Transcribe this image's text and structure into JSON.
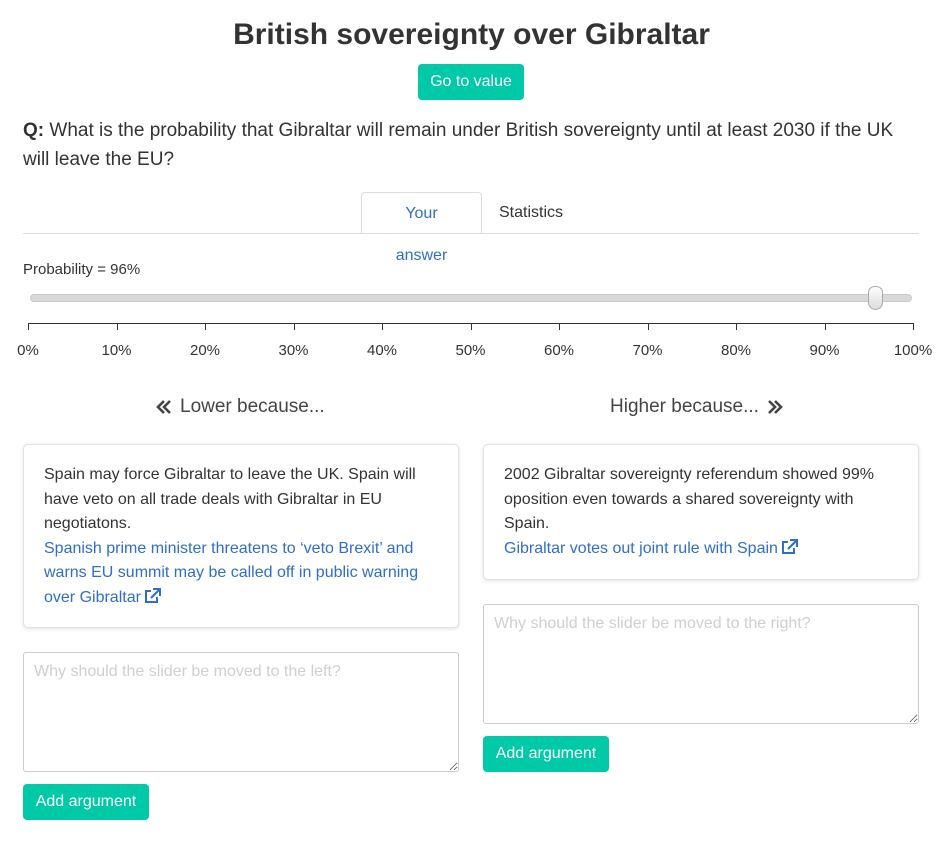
{
  "page": {
    "title": "British sovereignty over Gibraltar",
    "go_button": "Go to value"
  },
  "question": {
    "prefix": "Q:",
    "text": "What is the probability that Gibraltar will remain under British sovereignty until at least 2030 if the UK will leave the EU?"
  },
  "tabs": [
    {
      "label": "Your answer",
      "active": true
    },
    {
      "label": "Statistics",
      "active": false
    }
  ],
  "slider": {
    "label": "Probability = 96%",
    "value_percent": 96,
    "ticks": [
      "0%",
      "10%",
      "20%",
      "30%",
      "40%",
      "50%",
      "60%",
      "70%",
      "80%",
      "90%",
      "100%"
    ]
  },
  "lower": {
    "heading": "Lower because...",
    "argument_text": "Spain may force Gibraltar to leave the UK. Spain will have veto on all trade deals with Gibraltar in EU negotiatons.",
    "link_text": "Spanish prime minister threatens to ‘veto Brexit’ and warns EU summit may be called off in public warning over Gibraltar",
    "placeholder": "Why should the slider be moved to the left?",
    "add_button": "Add argument"
  },
  "higher": {
    "heading": "Higher because...",
    "argument_text": "2002 Gibraltar sovereignty referendum showed 99% oposition even towards a shared sovereignty with Spain.",
    "link_text": "Gibraltar votes out joint rule with Spain",
    "placeholder": "Why should the slider be moved to the right?",
    "add_button": "Add argument"
  },
  "colors": {
    "accent": "#00c9a7",
    "link": "#2f6fc4",
    "text": "#333333"
  },
  "icons": {
    "lower": "double-chevron-left-icon",
    "higher": "double-chevron-right-icon",
    "link": "external-link-icon"
  }
}
